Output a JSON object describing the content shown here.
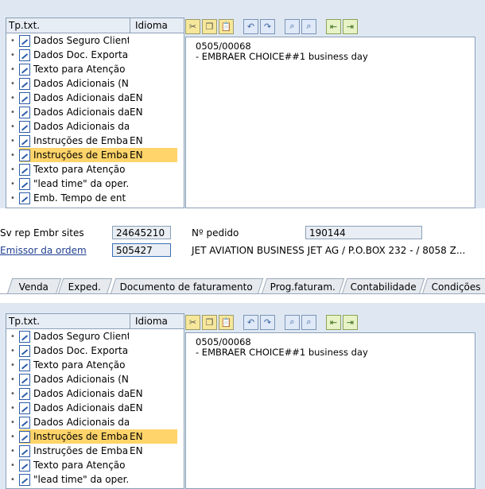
{
  "tree_panel": {
    "col_type": "Tp.txt.",
    "col_lang": "Idioma",
    "top_rows": [
      {
        "label": "Dados Seguro Cliente",
        "lang": ""
      },
      {
        "label": "Dados Doc. Exportação",
        "lang": ""
      },
      {
        "label": "Texto para Atenção",
        "lang": ""
      },
      {
        "label": "Dados Adicionais (NF)",
        "lang": ""
      },
      {
        "label": "Dados Adicionais da",
        "lang": "EN"
      },
      {
        "label": "Dados Adicionais da",
        "lang": "EN"
      },
      {
        "label": "Dados Adicionais da",
        "lang": ""
      },
      {
        "label": "Instruções de Emba",
        "lang": "EN"
      },
      {
        "label": "Instruções de Emba",
        "lang": "EN",
        "selected": true
      },
      {
        "label": "Texto para Atenção",
        "lang": ""
      },
      {
        "label": "\"lead time\" da oper.",
        "lang": ""
      },
      {
        "label": "Emb. Tempo de ent",
        "lang": ""
      }
    ],
    "bottom_rows": [
      {
        "label": "Dados Seguro Cliente",
        "lang": ""
      },
      {
        "label": "Dados Doc. Exportação",
        "lang": ""
      },
      {
        "label": "Texto para Atenção",
        "lang": ""
      },
      {
        "label": "Dados Adicionais (NF)",
        "lang": ""
      },
      {
        "label": "Dados Adicionais da",
        "lang": "EN"
      },
      {
        "label": "Dados Adicionais da",
        "lang": "EN"
      },
      {
        "label": "Dados Adicionais da",
        "lang": ""
      },
      {
        "label": "Instruções de Emba",
        "lang": "EN",
        "selected": true
      },
      {
        "label": "Instruções de Emba",
        "lang": "EN"
      },
      {
        "label": "Texto para Atenção",
        "lang": ""
      },
      {
        "label": "\"lead time\" da oper.",
        "lang": ""
      }
    ]
  },
  "editor": {
    "line1": "0505/00068",
    "line2": "- EMBRAER CHOICE##1 business day"
  },
  "header": {
    "svrep_label": "Sv rep Embr sites",
    "svrep_value": "24645210",
    "pedido_label": "Nº pedido",
    "pedido_value": "190144",
    "emissor_label": "Emissor da ordem",
    "emissor_value": "505427",
    "emissor_name": "JET AVIATION BUSINESS JET AG / P.O.BOX 232 - / 8058 Z..."
  },
  "tabs": [
    "Venda",
    "Exped.",
    "Documento de faturamento",
    "Prog.faturam.",
    "Contabilidade",
    "Condições"
  ],
  "colors": {
    "selection": "#ffd46a",
    "panel_bg": "#dfe8f2",
    "link": "#1f3f8f"
  }
}
